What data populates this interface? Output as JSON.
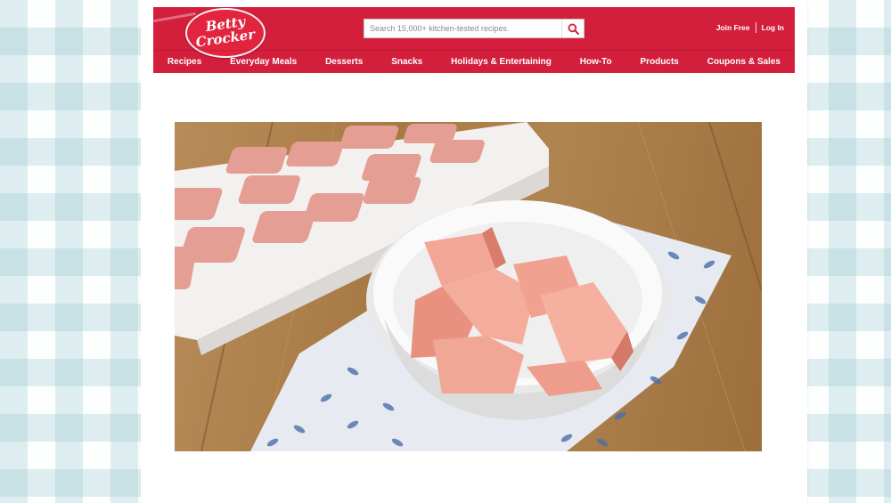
{
  "brand": {
    "logo_line1": "Betty",
    "logo_line2": "Crocker"
  },
  "search": {
    "placeholder": "Search 15,000+ kitchen-tested recipes."
  },
  "account": {
    "join": "Join Free",
    "login": "Log In"
  },
  "nav": [
    {
      "label": "Recipes"
    },
    {
      "label": "Everyday Meals"
    },
    {
      "label": "Desserts"
    },
    {
      "label": "Snacks"
    },
    {
      "label": "Holidays & Entertaining"
    },
    {
      "label": "How-To"
    },
    {
      "label": "Products"
    },
    {
      "label": "Coupons & Sales"
    }
  ],
  "icons": {
    "search": "search-icon"
  },
  "colors": {
    "brand_red": "#d31f3c",
    "background_check": "#96c6cd"
  }
}
